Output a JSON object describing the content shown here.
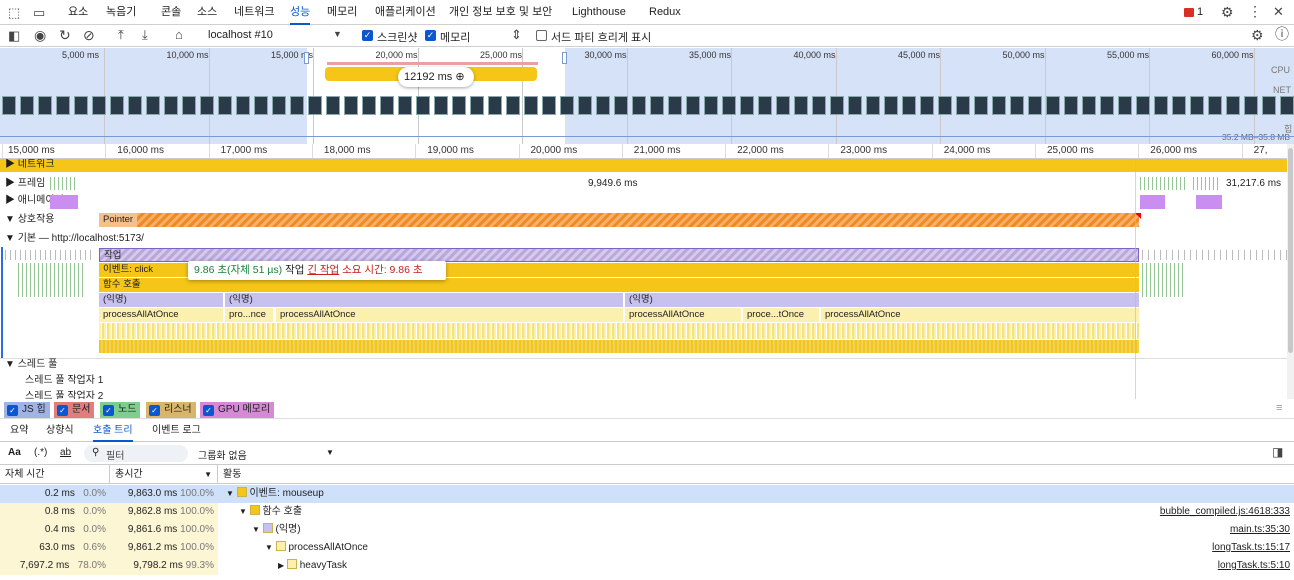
{
  "tabs": [
    "요소",
    "녹음기",
    "콘솔",
    "소스",
    "네트워크",
    "성능",
    "메모리",
    "애플리케이션",
    "개인 정보 보호 및 보안",
    "Lighthouse",
    "Redux"
  ],
  "active_tab_index": 5,
  "issues_count": "1",
  "toolbar": {
    "target": "localhost #10",
    "screenshot_label": "스크린샷",
    "memory_label": "메모리",
    "third_party_label": "서드 파티 흐리게 표시"
  },
  "overview": {
    "ticks": [
      "5,000 ms",
      "10,000 ms",
      "15,000 ms",
      "20,000 ms",
      "25,000 ms",
      "30,000 ms",
      "35,000 ms",
      "40,000 ms",
      "45,000 ms",
      "50,000 ms",
      "55,000 ms",
      "60,000 ms"
    ],
    "selection_duration": "12192 ms",
    "cpu_label": "CPU",
    "net_label": "NET",
    "heap_label": "힙",
    "heap_range": "35.2 MB–35.8 MB"
  },
  "ruler_ticks": [
    "15,000 ms",
    "16,000 ms",
    "17,000 ms",
    "18,000 ms",
    "19,000 ms",
    "20,000 ms",
    "21,000 ms",
    "22,000 ms",
    "23,000 ms",
    "24,000 ms",
    "25,000 ms",
    "26,000 ms",
    "27,"
  ],
  "tracks": {
    "network": "네트워크",
    "frames": "프레임",
    "frames_value_1": "9,949.6 ms",
    "frames_value_2": "31,217.6 ms",
    "animations": "애니메이션",
    "interactions": "상호작용",
    "pointer_label": "Pointer",
    "main": "기본 — http://localhost:5173/",
    "thread_pool": "스레드 풀",
    "thread_pool_worker_1": "스레드 풀 작업자 1",
    "thread_pool_worker_2": "스레드 풀 작업자 2"
  },
  "flame": {
    "task": "작업",
    "event_click": "이벤트: click",
    "function_call": "함수 호출",
    "anon": "(익명)",
    "process_all": "processAllAtOnce",
    "pro_nce": "pro...nce",
    "proce_tonce": "proce...tOnce"
  },
  "tooltip": {
    "duration": "9.86 초(자체 51 µs)",
    "task": "작업",
    "long_task": "긴 작업",
    "long_task_suffix": "소요 시간: 9.86 초"
  },
  "legend": [
    "JS 힙",
    "문서",
    "노드",
    "리스너",
    "GPU 메모리"
  ],
  "legend_colors": [
    "#9fb4e4",
    "#e07d7d",
    "#7ccf8e",
    "#d9b56b",
    "#d68ad6"
  ],
  "subtabs": [
    "요약",
    "상향식",
    "호출 트리",
    "이벤트 로그"
  ],
  "active_subtab_index": 2,
  "filter": {
    "aa": "Aa",
    "regex": "(.*)",
    "whole_word": "ab",
    "placeholder": "필터",
    "grouping": "그룹화 없음"
  },
  "table": {
    "headers": {
      "self_time": "자체 시간",
      "total_time": "총시간",
      "activity": "활동"
    },
    "rows": [
      {
        "self": "0.2 ms",
        "self_pct": "0.0%",
        "total": "9,863.0 ms",
        "total_pct": "100.0%",
        "name": "이벤트: mouseup",
        "source": "",
        "color": "#f5c518",
        "indent": 0,
        "expanded": true
      },
      {
        "self": "0.8 ms",
        "self_pct": "0.0%",
        "total": "9,862.8 ms",
        "total_pct": "100.0%",
        "name": "함수 호출",
        "source": "bubble_compiled.js:4618:333",
        "color": "#f5c518",
        "indent": 1,
        "expanded": true
      },
      {
        "self": "0.4 ms",
        "self_pct": "0.0%",
        "total": "9,861.6 ms",
        "total_pct": "100.0%",
        "name": "(익명)",
        "source": "main.ts:35:30",
        "color": "#c7c1f0",
        "indent": 2,
        "expanded": true
      },
      {
        "self": "63.0 ms",
        "self_pct": "0.6%",
        "total": "9,861.2 ms",
        "total_pct": "100.0%",
        "name": "processAllAtOnce",
        "source": "longTask.ts:15:17",
        "color": "#fbf0ad",
        "indent": 3,
        "expanded": true
      },
      {
        "self": "7,697.2 ms",
        "self_pct": "78.0%",
        "total": "9,798.2 ms",
        "total_pct": "99.3%",
        "name": "heavyTask",
        "source": "longTask.ts:5:10",
        "color": "#fbf0ad",
        "indent": 4,
        "expanded": false
      }
    ]
  }
}
